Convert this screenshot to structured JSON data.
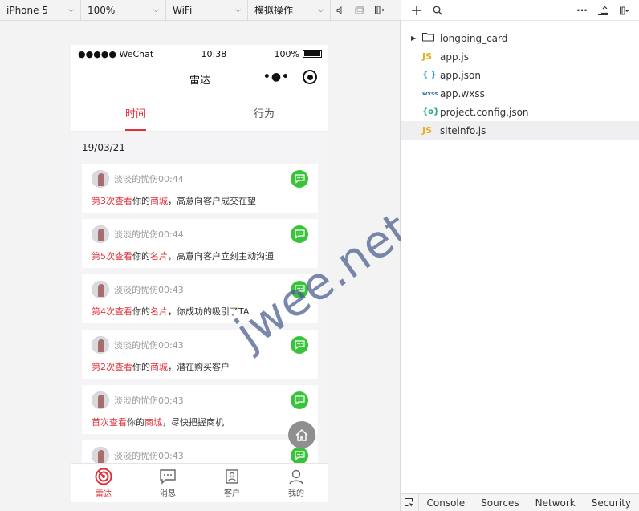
{
  "toolbar": {
    "device": "iPhone 5",
    "zoom": "100%",
    "network": "WiFi",
    "operation": "模拟操作"
  },
  "phone": {
    "status": {
      "signal": "●●●●● WeChat",
      "time": "10:38",
      "battery": "100%"
    },
    "nav_title": "雷达",
    "tabs": [
      {
        "label": "时间",
        "active": true
      },
      {
        "label": "行为",
        "active": false
      }
    ],
    "date_header": "19/03/21",
    "cards": [
      {
        "name_time": "淡淡的忧伤00:44",
        "count": "第3次查看",
        "mid": "你的",
        "target": "商城",
        "rest": "，高意向客户成交在望"
      },
      {
        "name_time": "淡淡的忧伤00:44",
        "count": "第5次查看",
        "mid": "你的",
        "target": "名片",
        "rest": "，高意向客户立刻主动沟通"
      },
      {
        "name_time": "淡淡的忧伤00:43",
        "count": "第4次查看",
        "mid": "你的",
        "target": "名片",
        "rest": "，你成功的吸引了TA"
      },
      {
        "name_time": "淡淡的忧伤00:43",
        "count": "第2次查看",
        "mid": "你的",
        "target": "商城",
        "rest": "，潜在购买客户"
      },
      {
        "name_time": "淡淡的忧伤00:43",
        "count": "首次查看",
        "mid": "你的",
        "target": "商城",
        "rest": "，尽快把握商机"
      },
      {
        "name_time": "淡淡的忧伤00:43",
        "count": "",
        "mid": "",
        "target": "",
        "rest": ""
      }
    ],
    "bottom_nav": [
      {
        "label": "雷达",
        "icon": "radar-icon",
        "active": true
      },
      {
        "label": "消息",
        "icon": "message-icon",
        "active": false
      },
      {
        "label": "客户",
        "icon": "customer-icon",
        "active": false
      },
      {
        "label": "我的",
        "icon": "profile-icon",
        "active": false
      }
    ]
  },
  "watermark": "jwee.net",
  "file_tree": {
    "items": [
      {
        "name": "longbing_card",
        "type": "folder",
        "icon": "folder-icon"
      },
      {
        "name": "app.js",
        "type": "js",
        "icon_text": "JS"
      },
      {
        "name": "app.json",
        "type": "json",
        "icon_text": "{ }"
      },
      {
        "name": "app.wxss",
        "type": "wxss",
        "icon_text": "wxss"
      },
      {
        "name": "project.config.json",
        "type": "config",
        "icon_text": "{o}"
      },
      {
        "name": "siteinfo.js",
        "type": "js",
        "icon_text": "JS",
        "selected": true
      }
    ]
  },
  "devtools_tabs": [
    "Console",
    "Sources",
    "Network",
    "Security"
  ],
  "colors": {
    "accent": "#e0303b",
    "chat": "#39c33a",
    "selected_row": "#efeff1"
  }
}
